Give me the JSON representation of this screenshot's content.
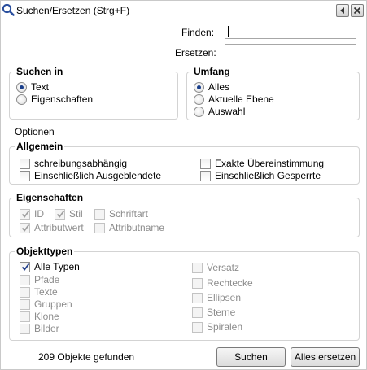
{
  "window": {
    "title": "Suchen/Ersetzen (Strg+F)",
    "icon": "search-magnifier-icon",
    "controls": [
      "restore-icon",
      "close-icon"
    ]
  },
  "fields": {
    "find_label": "Finden:",
    "find_value": "",
    "replace_label": "Ersetzen:",
    "replace_value": ""
  },
  "search_in": {
    "title": "Suchen in",
    "options": [
      {
        "label": "Text",
        "selected": true
      },
      {
        "label": "Eigenschaften",
        "selected": false
      }
    ]
  },
  "scope": {
    "title": "Umfang",
    "options": [
      {
        "label": "Alles",
        "selected": true
      },
      {
        "label": "Aktuelle Ebene",
        "selected": false
      },
      {
        "label": "Auswahl",
        "selected": false
      }
    ]
  },
  "options_heading": "Optionen",
  "general": {
    "title": "Allgemein",
    "items": [
      {
        "label": "schreibungsabhängig",
        "checked": false
      },
      {
        "label": "Exakte Übereinstimmung",
        "checked": false
      },
      {
        "label": "Einschließlich Ausgeblendete",
        "checked": false
      },
      {
        "label": "Einschließlich Gesperrte",
        "checked": false
      }
    ]
  },
  "properties": {
    "title": "Eigenschaften",
    "items": [
      {
        "label": "ID",
        "checked": true,
        "enabled": false
      },
      {
        "label": "Stil",
        "checked": true,
        "enabled": false
      },
      {
        "label": "Schriftart",
        "checked": false,
        "enabled": false
      },
      {
        "label": "Attributwert",
        "checked": true,
        "enabled": false
      },
      {
        "label": "Attributname",
        "checked": false,
        "enabled": false
      }
    ]
  },
  "object_types": {
    "title": "Objekttypen",
    "left": [
      {
        "label": "Alle Typen",
        "checked": true,
        "enabled": true
      },
      {
        "label": "Pfade",
        "checked": false,
        "enabled": false
      },
      {
        "label": "Texte",
        "checked": false,
        "enabled": false
      },
      {
        "label": "Gruppen",
        "checked": false,
        "enabled": false
      },
      {
        "label": "Klone",
        "checked": false,
        "enabled": false
      },
      {
        "label": "Bilder",
        "checked": false,
        "enabled": false
      }
    ],
    "right": [
      {
        "label": "Versatz",
        "checked": false,
        "enabled": false
      },
      {
        "label": "Rechtecke",
        "checked": false,
        "enabled": false
      },
      {
        "label": "Ellipsen",
        "checked": false,
        "enabled": false
      },
      {
        "label": "Sterne",
        "checked": false,
        "enabled": false
      },
      {
        "label": "Spiralen",
        "checked": false,
        "enabled": false
      }
    ]
  },
  "footer": {
    "status": "209 Objekte gefunden",
    "search_button": "Suchen",
    "replace_all_button": "Alles ersetzen"
  }
}
